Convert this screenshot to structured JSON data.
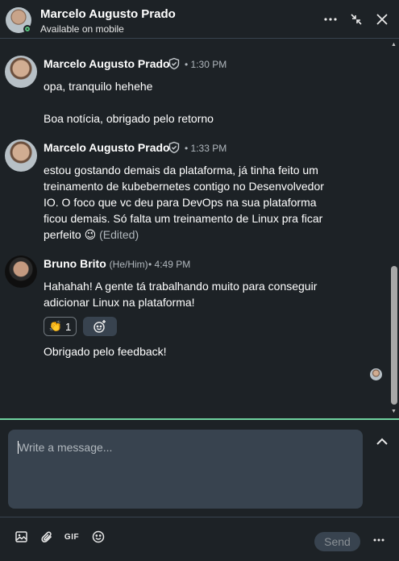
{
  "header": {
    "name": "Marcelo Augusto Prado",
    "status": "Available on mobile"
  },
  "messages": [
    {
      "sender": "Marcelo Augusto Prado",
      "time": "• 1:30 PM",
      "lines": [
        "opa, tranquilo hehehe",
        "Boa notícia, obrigado pelo retorno"
      ]
    },
    {
      "sender": "Marcelo Augusto Prado",
      "time": "• 1:33 PM",
      "text": "estou gostando demais da plataforma, já tinha feito um treinamento de kubebernetes contigo no Desenvolvedor IO. O foco que vc deu para DevOps na sua plataforma ficou demais. Só falta um treinamento de Linux pra ficar perfeito",
      "emoji": "😉",
      "edited": "(Edited)"
    },
    {
      "sender": "Bruno Brito",
      "pronoun": "(He/Him)",
      "time": "• 4:49 PM",
      "text": "Hahahah! A gente tá trabalhando muito para conseguir adicionar Linux na plataforma!",
      "reaction": {
        "emoji": "👏",
        "count": "1"
      },
      "followup": "Obrigado pelo feedback!"
    }
  ],
  "composer": {
    "placeholder": "Write a message..."
  },
  "footer": {
    "gif_label": "GIF",
    "send_label": "Send"
  },
  "colors": {
    "background": "#1d2226",
    "composer": "#38434f",
    "accent_focus": "#6fd3a0",
    "online": "#57c27e"
  }
}
